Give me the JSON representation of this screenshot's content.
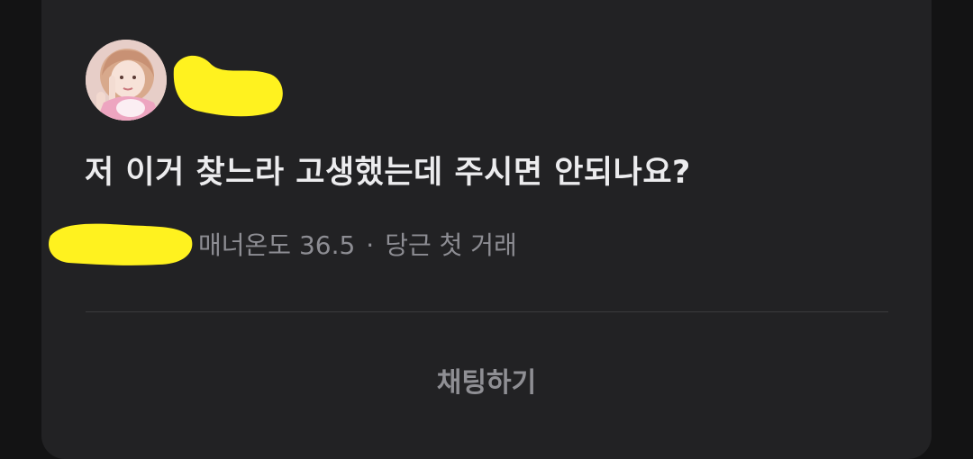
{
  "offer": {
    "message": "저 이거 찾느라 고생했는데 주시면 안되나요?",
    "manner_label": "매너온도",
    "manner_temp": "36.5",
    "separator": "·",
    "trade_badge": "당근 첫 거래"
  },
  "actions": {
    "chat_label": "채팅하기"
  },
  "colors": {
    "redaction": "#fff21f",
    "card_background": "#222224",
    "page_background": "#131314"
  }
}
